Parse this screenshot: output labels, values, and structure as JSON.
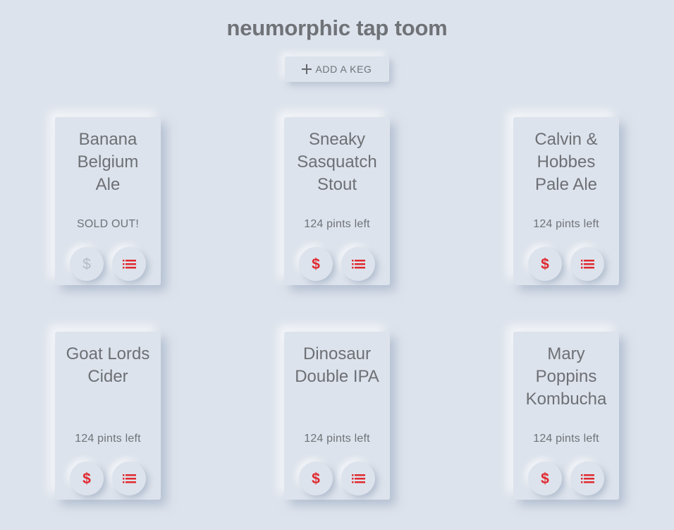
{
  "app": {
    "title": "neumorphic tap toom",
    "add_button_label": "ADD A KEG"
  },
  "colors": {
    "background": "#dde3ec",
    "accent": "#e0282e",
    "disabled_icon": "#b4bcc8",
    "text": "#6d7075"
  },
  "icons": {
    "add": "plus-icon",
    "buy": "dollar-icon",
    "details": "list-icon"
  },
  "kegs": [
    {
      "name": "Banana Belgium Ale",
      "status": "SOLD OUT!",
      "sold_out": true,
      "buy_icon_glyph": "$"
    },
    {
      "name": "Sneaky Sasquatch Stout",
      "status": "124 pints left",
      "sold_out": false,
      "buy_icon_glyph": "$"
    },
    {
      "name": "Calvin & Hobbes Pale Ale",
      "status": "124 pints left",
      "sold_out": false,
      "buy_icon_glyph": "$"
    },
    {
      "name": "Goat Lords Cider",
      "status": "124 pints left",
      "sold_out": false,
      "buy_icon_glyph": "$"
    },
    {
      "name": "Dinosaur Double IPA",
      "status": "124 pints left",
      "sold_out": false,
      "buy_icon_glyph": "$"
    },
    {
      "name": "Mary Poppins Kombucha",
      "status": "124 pints left",
      "sold_out": false,
      "buy_icon_glyph": "$"
    }
  ]
}
